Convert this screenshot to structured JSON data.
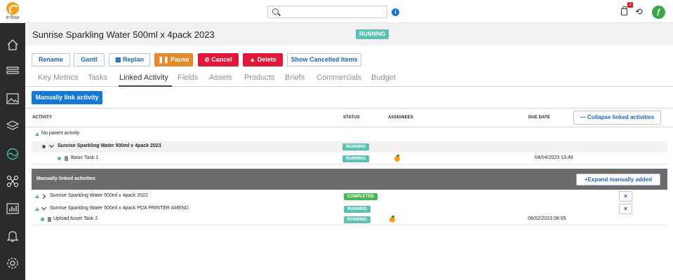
{
  "app": {
    "logo_text": "e-flow"
  },
  "topbar": {
    "search_placeholder": "",
    "cart_badge": "2",
    "avatar_letter": "ƒ"
  },
  "header": {
    "title": "Sunrise Sparkling Water 500ml x 4pack 2023",
    "status": "RUNNING"
  },
  "toolbar": {
    "rename": "Rename",
    "gantt": "Gantt",
    "replan": "Replan",
    "pause": "Pause",
    "cancel": "Cancel",
    "delete": "Delete",
    "show_cancelled": "Show Cancelled Items"
  },
  "tabs": [
    {
      "label": "Key Metrics"
    },
    {
      "label": "Tasks"
    },
    {
      "label": "Linked Activity"
    },
    {
      "label": "Fields"
    },
    {
      "label": "Assets"
    },
    {
      "label": "Products"
    },
    {
      "label": "Briefs"
    },
    {
      "label": "Commercials"
    },
    {
      "label": "Budget"
    }
  ],
  "active_tab": "Linked Activity",
  "manual_link_button": "Manually link activity",
  "table": {
    "headers": {
      "activity": "ACTIVITY",
      "status": "STATUS",
      "assignees": "ASSIGNEES",
      "due_date": "DUE DATE"
    },
    "collapse_button": "Collapse linked activities",
    "parent_row": "No parent activity",
    "current": {
      "name": "Sunrise Sparkling Water 500ml x 4pack 2023",
      "status": "RUNNING"
    },
    "current_task": {
      "name": "Basic Task 1",
      "status": "RUNNING",
      "due": "04/04/2023 13:49"
    },
    "manual_section": {
      "title": "Manually linked activities",
      "expand_button": "Expand manually added"
    },
    "manual_rows": [
      {
        "name": "Sunrise Sparkling Water 500ml x 4pack 2022",
        "status": "COMPLETED"
      },
      {
        "name": "Sunrise Sparkling Water 500ml x 4pack PDA PRINTER AMEND",
        "status": "RUNNING"
      }
    ],
    "manual_task": {
      "name": "Upload Asset Task 2",
      "status": "RUNNING",
      "due": "08/02/2023 08:05"
    },
    "remove_symbol": "×"
  },
  "colors": {
    "accent": "#1577d6",
    "running": "#5cc0b4",
    "completed": "#4ab552",
    "pause": "#e6892b",
    "danger": "#e0183a",
    "sidebar": "#2b2b2b"
  }
}
